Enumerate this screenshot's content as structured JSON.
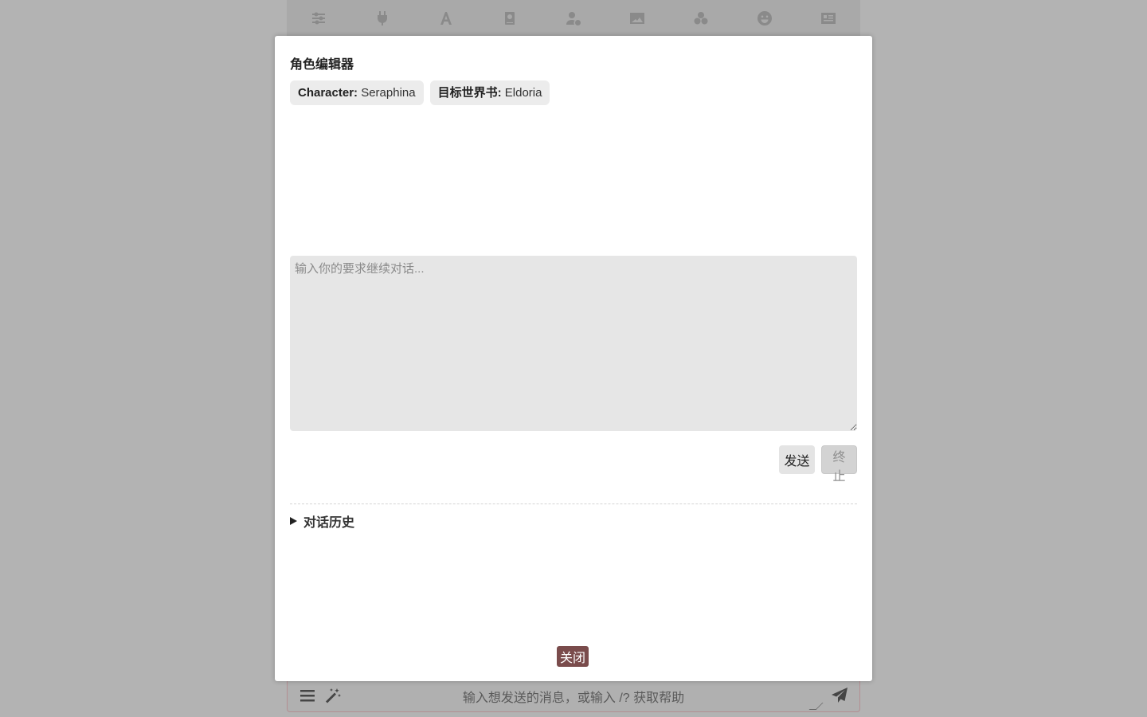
{
  "toolbar": {
    "icons": [
      "sliders-icon",
      "plug-icon",
      "font-icon",
      "book-icon",
      "user-gear-icon",
      "image-icon",
      "cubes-icon",
      "smile-icon",
      "id-card-icon"
    ]
  },
  "modal": {
    "title": "角色编辑器",
    "character_label": "Character:",
    "character_value": "Seraphina",
    "worldbook_label": "目标世界书:",
    "worldbook_value": "Eldoria",
    "prompt_placeholder": "输入你的要求继续对话...",
    "send_label": "发送",
    "stop_label": "终止",
    "history_label": "对话历史",
    "close_label": "关闭"
  },
  "chat_input": {
    "placeholder": "输入想发送的消息，或输入 /? 获取帮助"
  },
  "colors": {
    "close_button": "#7a4c4c",
    "overlay": "#b3b3b3"
  }
}
